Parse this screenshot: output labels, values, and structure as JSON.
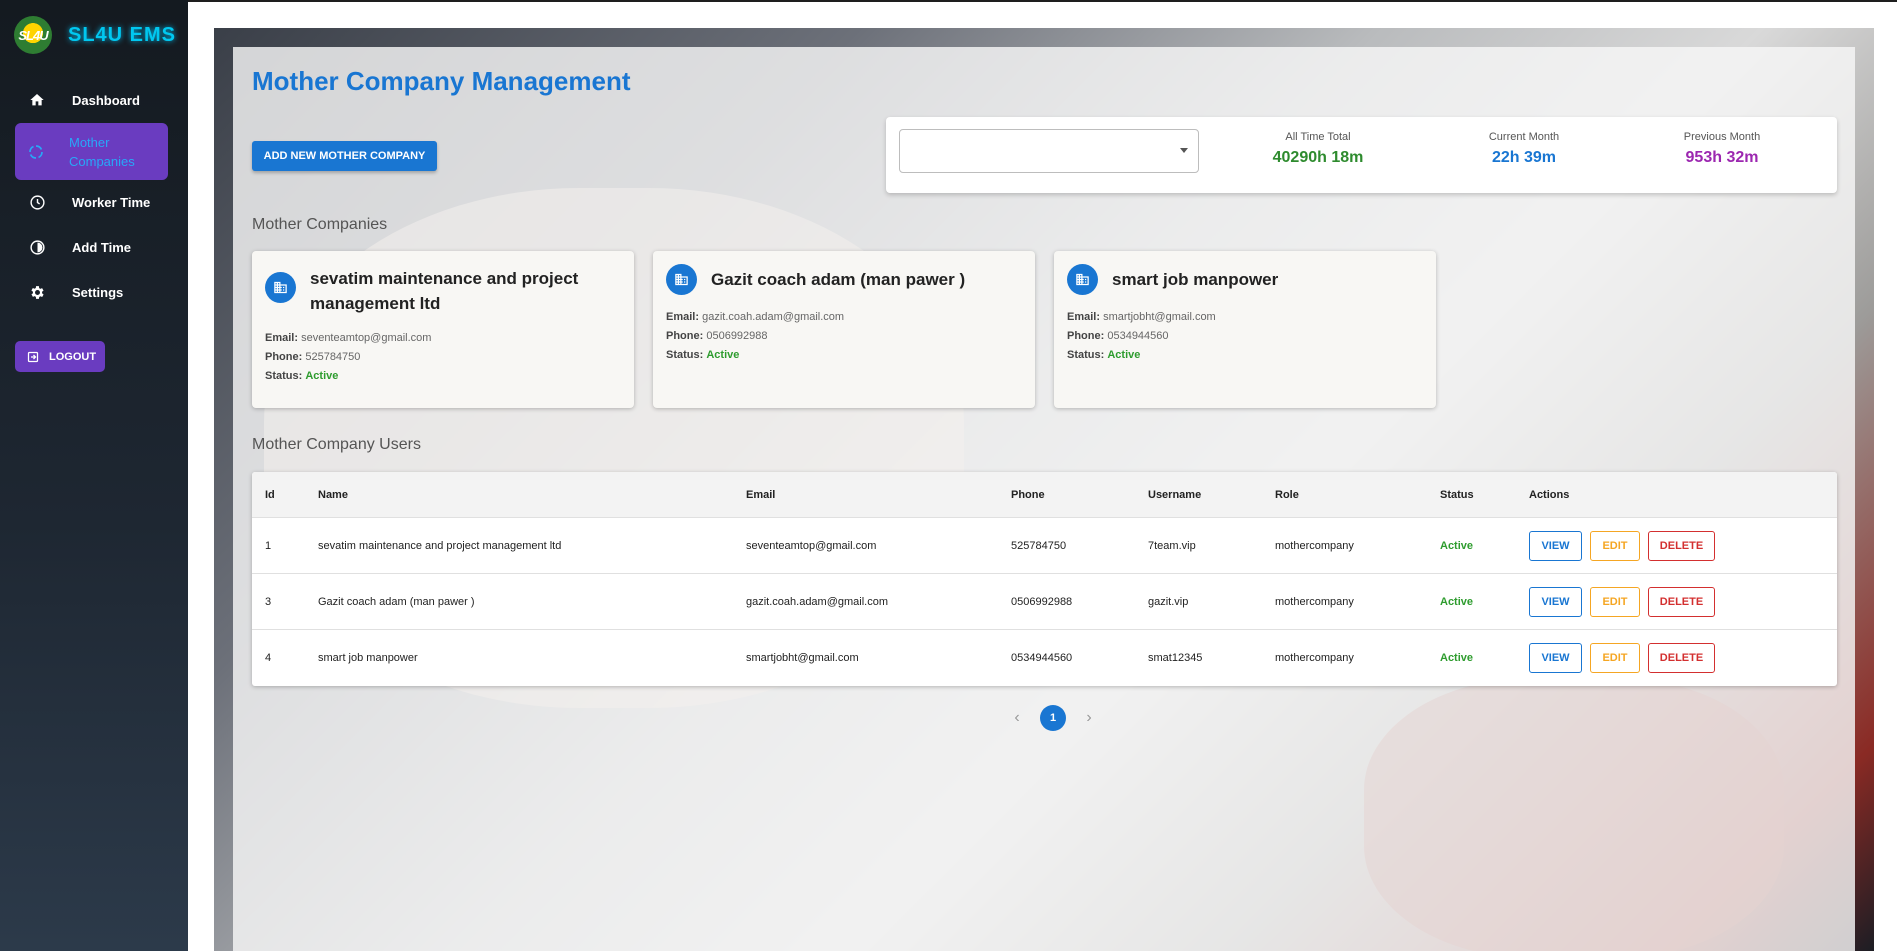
{
  "brand": {
    "logo_text": "SL4U",
    "name": "SL4U EMS"
  },
  "sidebar": {
    "items": [
      {
        "label": "Dashboard",
        "icon": "home-icon"
      },
      {
        "label": "Mother Companies",
        "icon": "spinner-icon"
      },
      {
        "label": "Worker Time",
        "icon": "clock-icon"
      },
      {
        "label": "Add Time",
        "icon": "timer-icon"
      },
      {
        "label": "Settings",
        "icon": "gear-icon"
      }
    ],
    "active_index": 1,
    "logout_label": "LOGOUT"
  },
  "page": {
    "title": "Mother Company Management",
    "add_button_label": "ADD NEW MOTHER COMPANY"
  },
  "stats": {
    "select_value": "",
    "all_time": {
      "label": "All Time Total",
      "value": "40290h 18m",
      "color": "#2e8b2e"
    },
    "current_month": {
      "label": "Current Month",
      "value": "22h 39m",
      "color": "#1976d2"
    },
    "previous_month": {
      "label": "Previous Month",
      "value": "953h 32m",
      "color": "#9c27b0"
    }
  },
  "companies_section_title": "Mother Companies",
  "companies": [
    {
      "name": "sevatim maintenance and project management ltd",
      "email_label": "Email:",
      "email": "seventeamtop@gmail.com",
      "phone_label": "Phone:",
      "phone": "525784750",
      "status_label": "Status:",
      "status": "Active"
    },
    {
      "name": "Gazit coach adam (man pawer )",
      "email_label": "Email:",
      "email": "gazit.coah.adam@gmail.com",
      "phone_label": "Phone:",
      "phone": "0506992988",
      "status_label": "Status:",
      "status": "Active"
    },
    {
      "name": "smart job manpower",
      "email_label": "Email:",
      "email": "smartjobht@gmail.com",
      "phone_label": "Phone:",
      "phone": "0534944560",
      "status_label": "Status:",
      "status": "Active"
    }
  ],
  "users_section_title": "Mother Company Users",
  "users_table": {
    "headers": [
      "Id",
      "Name",
      "Email",
      "Phone",
      "Username",
      "Role",
      "Status",
      "Actions"
    ],
    "rows": [
      {
        "id": "1",
        "name": "sevatim maintenance and project management ltd",
        "email": "seventeamtop@gmail.com",
        "phone": "525784750",
        "username": "7team.vip",
        "role": "mothercompany",
        "status": "Active"
      },
      {
        "id": "3",
        "name": "Gazit coach adam (man pawer )",
        "email": "gazit.coah.adam@gmail.com",
        "phone": "0506992988",
        "username": "gazit.vip",
        "role": "mothercompany",
        "status": "Active"
      },
      {
        "id": "4",
        "name": "smart job manpower",
        "email": "smartjobht@gmail.com",
        "phone": "0534944560",
        "username": "smat12345",
        "role": "mothercompany",
        "status": "Active"
      }
    ],
    "actions": {
      "view": "VIEW",
      "edit": "EDIT",
      "delete": "DELETE"
    }
  },
  "pagination": {
    "prev": "‹",
    "current_page": "1",
    "next": "›"
  }
}
